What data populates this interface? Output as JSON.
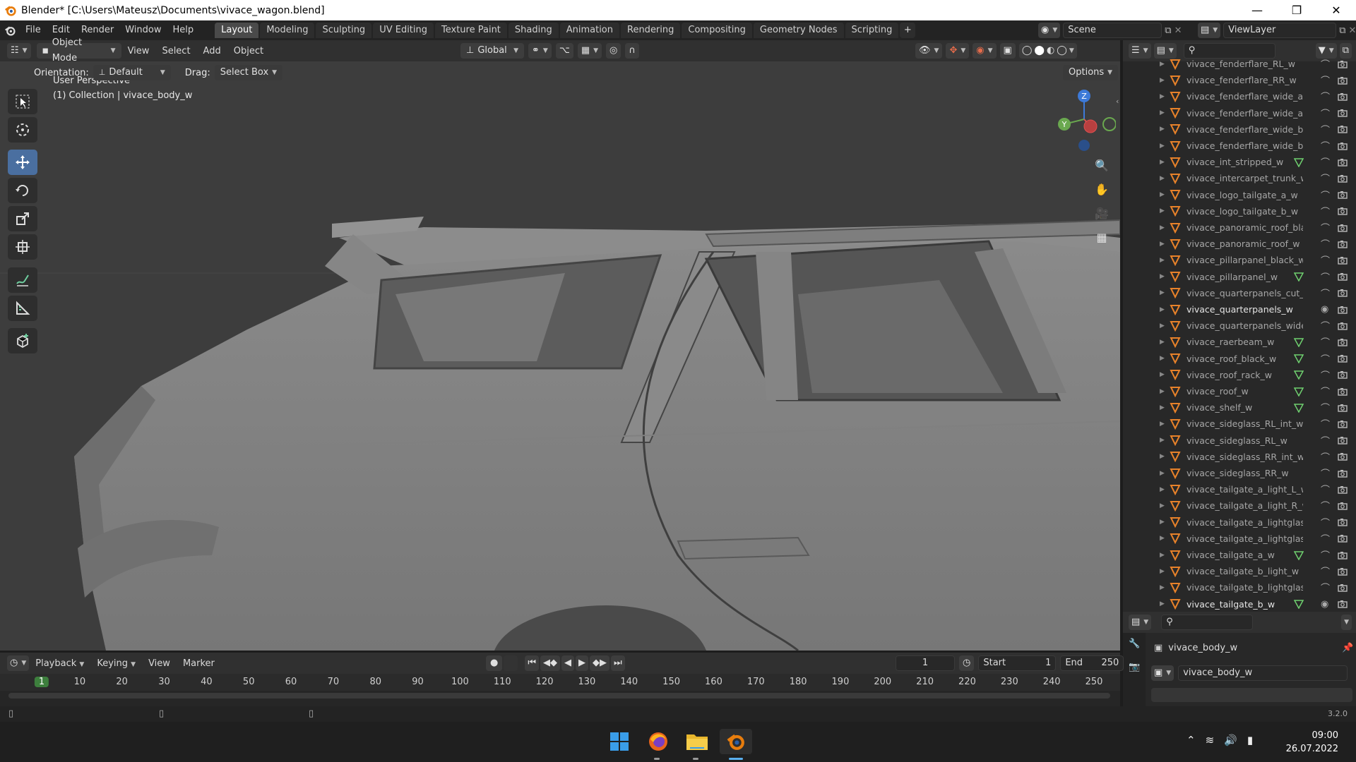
{
  "window": {
    "title": "Blender* [C:\\Users\\Mateusz\\Documents\\vivace_wagon.blend]"
  },
  "menu": [
    "File",
    "Edit",
    "Render",
    "Window",
    "Help"
  ],
  "workspaces": [
    "Layout",
    "Modeling",
    "Sculpting",
    "UV Editing",
    "Texture Paint",
    "Shading",
    "Animation",
    "Rendering",
    "Compositing",
    "Geometry Nodes",
    "Scripting"
  ],
  "active_workspace": "Layout",
  "scene": {
    "label": "Scene",
    "view_layer": "ViewLayer"
  },
  "viewport_header": {
    "mode": "Object Mode",
    "menus": [
      "View",
      "Select",
      "Add",
      "Object"
    ],
    "transform_orientation": "Global"
  },
  "tool_options": {
    "orientation_label": "Orientation:",
    "orientation_value": "Default",
    "drag_label": "Drag:",
    "drag_value": "Select Box",
    "options_label": "Options"
  },
  "viewport": {
    "perspective": "User Perspective",
    "collection": "(1) Collection | vivace_body_w",
    "background_color": "#3d3d3d"
  },
  "outliner": {
    "items": [
      {
        "name": "vivace_fenderflare_RL_w",
        "mod": false,
        "visible": false
      },
      {
        "name": "vivace_fenderflare_RR_w",
        "mod": false,
        "visible": false
      },
      {
        "name": "vivace_fenderflare_wide_a_",
        "mod": false,
        "visible": false
      },
      {
        "name": "vivace_fenderflare_wide_a_",
        "mod": false,
        "visible": false
      },
      {
        "name": "vivace_fenderflare_wide_b_",
        "mod": false,
        "visible": false
      },
      {
        "name": "vivace_fenderflare_wide_b_",
        "mod": false,
        "visible": false
      },
      {
        "name": "vivace_int_stripped_w",
        "mod": true,
        "visible": false
      },
      {
        "name": "vivace_intercarpet_trunk_w",
        "mod": false,
        "visible": false
      },
      {
        "name": "vivace_logo_tailgate_a_w",
        "mod": false,
        "visible": false
      },
      {
        "name": "vivace_logo_tailgate_b_w",
        "mod": false,
        "visible": false
      },
      {
        "name": "vivace_panoramic_roof_bla",
        "mod": false,
        "visible": false
      },
      {
        "name": "vivace_panoramic_roof_w",
        "mod": false,
        "visible": false
      },
      {
        "name": "vivace_pillarpanel_black_w",
        "mod": false,
        "visible": false
      },
      {
        "name": "vivace_pillarpanel_w",
        "mod": true,
        "visible": false
      },
      {
        "name": "vivace_quarterpanels_cut_v",
        "mod": false,
        "visible": false
      },
      {
        "name": "vivace_quarterpanels_w",
        "mod": false,
        "visible": true
      },
      {
        "name": "vivace_quarterpanels_wide",
        "mod": false,
        "visible": false
      },
      {
        "name": "vivace_raerbeam_w",
        "mod": true,
        "visible": false
      },
      {
        "name": "vivace_roof_black_w",
        "mod": true,
        "visible": false
      },
      {
        "name": "vivace_roof_rack_w",
        "mod": true,
        "visible": false
      },
      {
        "name": "vivace_roof_w",
        "mod": true,
        "visible": false
      },
      {
        "name": "vivace_shelf_w",
        "mod": true,
        "visible": false
      },
      {
        "name": "vivace_sideglass_RL_int_w",
        "mod": false,
        "visible": false
      },
      {
        "name": "vivace_sideglass_RL_w",
        "mod": false,
        "visible": false
      },
      {
        "name": "vivace_sideglass_RR_int_w",
        "mod": false,
        "visible": false
      },
      {
        "name": "vivace_sideglass_RR_w",
        "mod": false,
        "visible": false
      },
      {
        "name": "vivace_tailgate_a_light_L_w",
        "mod": false,
        "visible": false
      },
      {
        "name": "vivace_tailgate_a_light_R_w",
        "mod": false,
        "visible": false
      },
      {
        "name": "vivace_tailgate_a_lightglass",
        "mod": false,
        "visible": false
      },
      {
        "name": "vivace_tailgate_a_lightglass",
        "mod": false,
        "visible": false
      },
      {
        "name": "vivace_tailgate_a_w",
        "mod": true,
        "visible": false
      },
      {
        "name": "vivace_tailgate_b_light_w",
        "mod": false,
        "visible": false
      },
      {
        "name": "vivace_tailgate_b_lightglass",
        "mod": false,
        "visible": false
      },
      {
        "name": "vivace_tailgate_b_w",
        "mod": true,
        "visible": true
      }
    ]
  },
  "properties": {
    "object_name": "vivace_body_w",
    "data_name": "vivace_body_w"
  },
  "timeline": {
    "menus": [
      "Playback",
      "Keying",
      "View",
      "Marker"
    ],
    "current_frame": "1",
    "start_label": "Start",
    "start": "1",
    "end_label": "End",
    "end": "250",
    "ticks": [
      "1",
      "10",
      "20",
      "30",
      "40",
      "50",
      "60",
      "70",
      "80",
      "90",
      "100",
      "110",
      "120",
      "130",
      "140",
      "150",
      "160",
      "170",
      "180",
      "190",
      "200",
      "210",
      "220",
      "230",
      "240",
      "250"
    ]
  },
  "status": {
    "version": "3.2.0"
  },
  "taskbar": {
    "time": "09:00",
    "date": "26.07.2022"
  },
  "colors": {
    "accent": "#e87d0d",
    "active_tab": "#4a4a4a",
    "tool_active": "#4a6fa0",
    "gizmo_x": "#e05050",
    "gizmo_y": "#6aa84f",
    "gizmo_z": "#3d7ad8"
  }
}
